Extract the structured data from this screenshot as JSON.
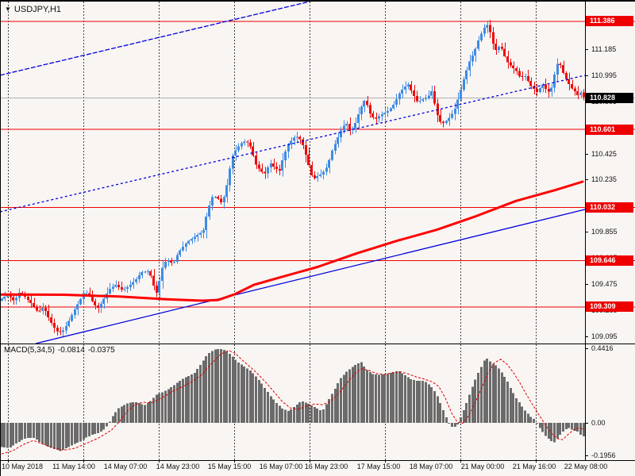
{
  "header": {
    "symbol_label": "USDJPY,H1"
  },
  "price_scale": {
    "ticks": [
      {
        "label": "111.375",
        "price": 111.375,
        "hidden": true
      },
      {
        "label": "111.185",
        "price": 111.185
      },
      {
        "label": "110.995",
        "price": 110.995
      },
      {
        "label": "110.805",
        "price": 110.805,
        "hidden": true
      },
      {
        "label": "110.615",
        "price": 110.615,
        "hidden": true
      },
      {
        "label": "110.425",
        "price": 110.425
      },
      {
        "label": "110.235",
        "price": 110.235
      },
      {
        "label": "110.045",
        "price": 110.045,
        "hidden": true
      },
      {
        "label": "109.855",
        "price": 109.855
      },
      {
        "label": "109.665",
        "price": 109.665,
        "hidden": true
      },
      {
        "label": "109.475",
        "price": 109.475
      },
      {
        "label": "109.285",
        "price": 109.285,
        "hidden": true
      },
      {
        "label": "109.095",
        "price": 109.095
      }
    ],
    "level_badges": [
      {
        "label": "111.386",
        "price": 111.386,
        "type": "red"
      },
      {
        "label": "110.828",
        "price": 110.828,
        "type": "black"
      },
      {
        "label": "110.601",
        "price": 110.601,
        "type": "red"
      },
      {
        "label": "110.032",
        "price": 110.032,
        "type": "red"
      },
      {
        "label": "109.646",
        "price": 109.646,
        "type": "red"
      },
      {
        "label": "109.309",
        "price": 109.309,
        "type": "red"
      }
    ]
  },
  "macd_panel": {
    "name": "MACD(5,34,5)",
    "value": "-0.0814",
    "signal": "-0.0375",
    "scale": [
      {
        "label": "0.4416",
        "value": 0.4416
      },
      {
        "label": "0.00",
        "value": 0.0
      },
      {
        "label": "-0.1956",
        "value": -0.1956
      }
    ]
  },
  "time_axis": {
    "labels": [
      "10 May 2018",
      "11 May 14:00",
      "14 May 07:00",
      "14 May 23:00",
      "15 May 15:00",
      "16 May 07:00",
      "16 May 23:00",
      "17 May 15:00",
      "18 May 07:00",
      "21 May 00:00",
      "21 May 16:00",
      "22 May 08:00"
    ]
  },
  "colors": {
    "background": "#f9f5f3",
    "candle_up": "#3d8be4",
    "candle_down": "#ee0a0a",
    "level_line": "#f00000",
    "ma_line": "#ff0000",
    "trend_line": "#0000dd",
    "current_price_line": "#b0b0b0",
    "macd_histogram": "#6b6b6b",
    "macd_signal": "#dd0000",
    "grid": "#444444",
    "badge_red": "#ee0000",
    "badge_black": "#000000"
  },
  "chart_data": {
    "type": "candlestick",
    "symbol": "USDJPY",
    "timeframe": "H1",
    "title": "USDJPY,H1",
    "indicator": "MACD(5,34,5)",
    "macd_current": -0.0814,
    "macd_signal_current": -0.0375,
    "current_price": 110.828,
    "levels": [
      111.386,
      110.601,
      110.032,
      109.646,
      109.309
    ],
    "price_axis": {
      "ylim": [
        109.049,
        111.53
      ],
      "tick_step": 0.19
    },
    "macd_axis": {
      "ylim": [
        -0.2171,
        0.4625
      ]
    },
    "n_candles": 200,
    "close_path": [
      [
        2,
        109.37
      ],
      [
        10,
        109.4
      ],
      [
        18,
        109.35
      ],
      [
        25,
        109.42
      ],
      [
        32,
        109.38
      ],
      [
        40,
        109.33
      ],
      [
        48,
        109.27
      ],
      [
        55,
        109.31
      ],
      [
        62,
        109.22
      ],
      [
        68,
        109.16
      ],
      [
        74,
        109.12
      ],
      [
        80,
        109.14
      ],
      [
        86,
        109.2
      ],
      [
        92,
        109.27
      ],
      [
        100,
        109.35
      ],
      [
        106,
        109.42
      ],
      [
        112,
        109.4
      ],
      [
        118,
        109.33
      ],
      [
        124,
        109.3
      ],
      [
        130,
        109.36
      ],
      [
        138,
        109.44
      ],
      [
        146,
        109.47
      ],
      [
        154,
        109.43
      ],
      [
        162,
        109.46
      ],
      [
        170,
        109.5
      ],
      [
        178,
        109.56
      ],
      [
        186,
        109.57
      ],
      [
        192,
        109.52
      ],
      [
        196,
        109.38
      ],
      [
        201,
        109.5
      ],
      [
        206,
        109.63
      ],
      [
        212,
        109.65
      ],
      [
        218,
        109.62
      ],
      [
        224,
        109.7
      ],
      [
        232,
        109.76
      ],
      [
        240,
        109.8
      ],
      [
        248,
        109.83
      ],
      [
        256,
        109.86
      ],
      [
        262,
        110.02
      ],
      [
        268,
        110.12
      ],
      [
        274,
        110.1
      ],
      [
        280,
        110.06
      ],
      [
        286,
        110.2
      ],
      [
        292,
        110.4
      ],
      [
        298,
        110.46
      ],
      [
        304,
        110.5
      ],
      [
        310,
        110.52
      ],
      [
        316,
        110.47
      ],
      [
        322,
        110.35
      ],
      [
        328,
        110.3
      ],
      [
        334,
        110.28
      ],
      [
        340,
        110.36
      ],
      [
        346,
        110.32
      ],
      [
        352,
        110.3
      ],
      [
        358,
        110.42
      ],
      [
        364,
        110.5
      ],
      [
        370,
        110.54
      ],
      [
        376,
        110.55
      ],
      [
        382,
        110.48
      ],
      [
        388,
        110.36
      ],
      [
        394,
        110.24
      ],
      [
        400,
        110.26
      ],
      [
        406,
        110.28
      ],
      [
        412,
        110.33
      ],
      [
        418,
        110.44
      ],
      [
        424,
        110.52
      ],
      [
        430,
        110.6
      ],
      [
        436,
        110.65
      ],
      [
        442,
        110.58
      ],
      [
        448,
        110.65
      ],
      [
        454,
        110.75
      ],
      [
        460,
        110.82
      ],
      [
        466,
        110.72
      ],
      [
        472,
        110.67
      ],
      [
        478,
        110.7
      ],
      [
        484,
        110.72
      ],
      [
        490,
        110.74
      ],
      [
        496,
        110.78
      ],
      [
        502,
        110.85
      ],
      [
        508,
        110.9
      ],
      [
        514,
        110.93
      ],
      [
        520,
        110.86
      ],
      [
        526,
        110.8
      ],
      [
        532,
        110.82
      ],
      [
        538,
        110.83
      ],
      [
        544,
        110.88
      ],
      [
        550,
        110.72
      ],
      [
        556,
        110.64
      ],
      [
        562,
        110.66
      ],
      [
        568,
        110.7
      ],
      [
        574,
        110.76
      ],
      [
        580,
        110.88
      ],
      [
        586,
        111.0
      ],
      [
        592,
        111.1
      ],
      [
        598,
        111.17
      ],
      [
        604,
        111.27
      ],
      [
        610,
        111.34
      ],
      [
        614,
        111.36
      ],
      [
        618,
        111.3
      ],
      [
        622,
        111.2
      ],
      [
        626,
        111.17
      ],
      [
        630,
        111.22
      ],
      [
        634,
        111.16
      ],
      [
        638,
        111.1
      ],
      [
        644,
        111.06
      ],
      [
        650,
        111.03
      ],
      [
        656,
        110.97
      ],
      [
        660,
        111.0
      ],
      [
        664,
        110.97
      ],
      [
        668,
        110.92
      ],
      [
        672,
        110.9
      ],
      [
        676,
        110.87
      ],
      [
        680,
        110.9
      ],
      [
        684,
        110.93
      ],
      [
        688,
        110.89
      ],
      [
        692,
        110.87
      ],
      [
        696,
        110.92
      ],
      [
        700,
        111.05
      ],
      [
        704,
        111.1
      ],
      [
        708,
        111.03
      ],
      [
        712,
        110.98
      ],
      [
        716,
        110.94
      ],
      [
        720,
        110.9
      ],
      [
        724,
        110.88
      ],
      [
        728,
        110.85
      ],
      [
        732,
        110.87
      ],
      [
        736,
        110.828
      ]
    ],
    "ma_path": [
      [
        2,
        109.4
      ],
      [
        80,
        109.398
      ],
      [
        150,
        109.385
      ],
      [
        210,
        109.365
      ],
      [
        255,
        109.355
      ],
      [
        275,
        109.36
      ],
      [
        295,
        109.4
      ],
      [
        320,
        109.47
      ],
      [
        350,
        109.52
      ],
      [
        400,
        109.6
      ],
      [
        450,
        109.7
      ],
      [
        500,
        109.79
      ],
      [
        550,
        109.87
      ],
      [
        600,
        109.97
      ],
      [
        650,
        110.08
      ],
      [
        700,
        110.16
      ],
      [
        734,
        110.22
      ]
    ],
    "trendlines": [
      {
        "name": "upper-channel",
        "style": "dashed",
        "points": [
          [
            0,
            110.994
          ],
          [
            390,
            111.53
          ]
        ]
      },
      {
        "name": "mid-channel",
        "style": "dotted",
        "points": [
          [
            0,
            110.001
          ],
          [
            737,
            110.994
          ]
        ]
      },
      {
        "name": "lower-channel",
        "style": "solid",
        "points": [
          [
            45,
            109.043
          ],
          [
            737,
            110.018
          ]
        ]
      }
    ],
    "macd_histogram": [
      [
        2,
        -0.145
      ],
      [
        12,
        -0.15
      ],
      [
        20,
        -0.125
      ],
      [
        28,
        -0.1
      ],
      [
        36,
        -0.088
      ],
      [
        44,
        -0.09
      ],
      [
        52,
        -0.12
      ],
      [
        60,
        -0.14
      ],
      [
        68,
        -0.155
      ],
      [
        76,
        -0.168
      ],
      [
        84,
        -0.15
      ],
      [
        92,
        -0.13
      ],
      [
        100,
        -0.115
      ],
      [
        108,
        -0.09
      ],
      [
        116,
        -0.072
      ],
      [
        124,
        -0.06
      ],
      [
        130,
        -0.045
      ],
      [
        136,
        -0.015
      ],
      [
        142,
        0.04
      ],
      [
        150,
        0.09
      ],
      [
        158,
        0.11
      ],
      [
        166,
        0.125
      ],
      [
        174,
        0.12
      ],
      [
        182,
        0.105
      ],
      [
        190,
        0.13
      ],
      [
        198,
        0.17
      ],
      [
        206,
        0.185
      ],
      [
        214,
        0.205
      ],
      [
        222,
        0.235
      ],
      [
        230,
        0.26
      ],
      [
        238,
        0.28
      ],
      [
        246,
        0.3
      ],
      [
        254,
        0.355
      ],
      [
        262,
        0.41
      ],
      [
        270,
        0.435
      ],
      [
        277,
        0.442
      ],
      [
        284,
        0.432
      ],
      [
        292,
        0.4
      ],
      [
        300,
        0.36
      ],
      [
        308,
        0.335
      ],
      [
        316,
        0.31
      ],
      [
        324,
        0.27
      ],
      [
        332,
        0.22
      ],
      [
        340,
        0.165
      ],
      [
        348,
        0.12
      ],
      [
        356,
        0.085
      ],
      [
        364,
        0.07
      ],
      [
        372,
        0.1
      ],
      [
        380,
        0.13
      ],
      [
        388,
        0.115
      ],
      [
        394,
        0.1
      ],
      [
        400,
        0.085
      ],
      [
        406,
        0.07
      ],
      [
        412,
        0.12
      ],
      [
        418,
        0.17
      ],
      [
        424,
        0.22
      ],
      [
        430,
        0.27
      ],
      [
        436,
        0.3
      ],
      [
        442,
        0.325
      ],
      [
        448,
        0.345
      ],
      [
        455,
        0.362
      ],
      [
        462,
        0.315
      ],
      [
        470,
        0.29
      ],
      [
        478,
        0.285
      ],
      [
        486,
        0.29
      ],
      [
        494,
        0.3
      ],
      [
        502,
        0.31
      ],
      [
        510,
        0.285
      ],
      [
        518,
        0.26
      ],
      [
        526,
        0.25
      ],
      [
        534,
        0.25
      ],
      [
        540,
        0.23
      ],
      [
        546,
        0.2
      ],
      [
        552,
        0.15
      ],
      [
        558,
        0.08
      ],
      [
        564,
        0.01
      ],
      [
        570,
        -0.028
      ],
      [
        576,
        -0.02
      ],
      [
        582,
        0.05
      ],
      [
        588,
        0.12
      ],
      [
        594,
        0.2
      ],
      [
        600,
        0.27
      ],
      [
        606,
        0.33
      ],
      [
        612,
        0.39
      ],
      [
        616,
        0.372
      ],
      [
        620,
        0.355
      ],
      [
        626,
        0.34
      ],
      [
        632,
        0.3
      ],
      [
        638,
        0.26
      ],
      [
        644,
        0.2
      ],
      [
        650,
        0.15
      ],
      [
        656,
        0.11
      ],
      [
        662,
        0.07
      ],
      [
        668,
        0.04
      ],
      [
        674,
        0.018
      ],
      [
        680,
        -0.03
      ],
      [
        686,
        -0.07
      ],
      [
        692,
        -0.1
      ],
      [
        698,
        -0.118
      ],
      [
        704,
        -0.08
      ],
      [
        710,
        -0.05
      ],
      [
        716,
        -0.028
      ],
      [
        722,
        -0.045
      ],
      [
        728,
        -0.052
      ],
      [
        734,
        -0.0814
      ]
    ],
    "macd_signal": [
      [
        2,
        -0.185
      ],
      [
        15,
        -0.168
      ],
      [
        30,
        -0.128
      ],
      [
        42,
        -0.105
      ],
      [
        55,
        -0.128
      ],
      [
        68,
        -0.15
      ],
      [
        80,
        -0.163
      ],
      [
        95,
        -0.15
      ],
      [
        110,
        -0.12
      ],
      [
        125,
        -0.088
      ],
      [
        140,
        -0.045
      ],
      [
        150,
        0.005
      ],
      [
        160,
        0.068
      ],
      [
        170,
        0.108
      ],
      [
        180,
        0.122
      ],
      [
        192,
        0.12
      ],
      [
        205,
        0.152
      ],
      [
        218,
        0.188
      ],
      [
        230,
        0.215
      ],
      [
        242,
        0.245
      ],
      [
        254,
        0.285
      ],
      [
        266,
        0.35
      ],
      [
        278,
        0.408
      ],
      [
        288,
        0.43
      ],
      [
        296,
        0.415
      ],
      [
        306,
        0.37
      ],
      [
        316,
        0.33
      ],
      [
        326,
        0.285
      ],
      [
        336,
        0.235
      ],
      [
        346,
        0.18
      ],
      [
        356,
        0.125
      ],
      [
        366,
        0.088
      ],
      [
        376,
        0.08
      ],
      [
        386,
        0.1
      ],
      [
        396,
        0.112
      ],
      [
        406,
        0.108
      ],
      [
        416,
        0.125
      ],
      [
        426,
        0.172
      ],
      [
        436,
        0.23
      ],
      [
        446,
        0.288
      ],
      [
        455,
        0.322
      ],
      [
        465,
        0.312
      ],
      [
        475,
        0.292
      ],
      [
        485,
        0.288
      ],
      [
        495,
        0.298
      ],
      [
        505,
        0.303
      ],
      [
        515,
        0.29
      ],
      [
        525,
        0.272
      ],
      [
        535,
        0.26
      ],
      [
        545,
        0.243
      ],
      [
        553,
        0.215
      ],
      [
        561,
        0.148
      ],
      [
        569,
        0.058
      ],
      [
        576,
        0.005
      ],
      [
        583,
        -0.003
      ],
      [
        591,
        0.045
      ],
      [
        599,
        0.125
      ],
      [
        607,
        0.21
      ],
      [
        615,
        0.298
      ],
      [
        623,
        0.358
      ],
      [
        631,
        0.378
      ],
      [
        639,
        0.348
      ],
      [
        647,
        0.298
      ],
      [
        655,
        0.238
      ],
      [
        663,
        0.17
      ],
      [
        671,
        0.108
      ],
      [
        679,
        0.048
      ],
      [
        687,
        -0.012
      ],
      [
        695,
        -0.062
      ],
      [
        702,
        -0.094
      ],
      [
        709,
        -0.1
      ],
      [
        716,
        -0.068
      ],
      [
        723,
        -0.04
      ],
      [
        729,
        -0.03
      ],
      [
        735,
        -0.0375
      ]
    ]
  }
}
